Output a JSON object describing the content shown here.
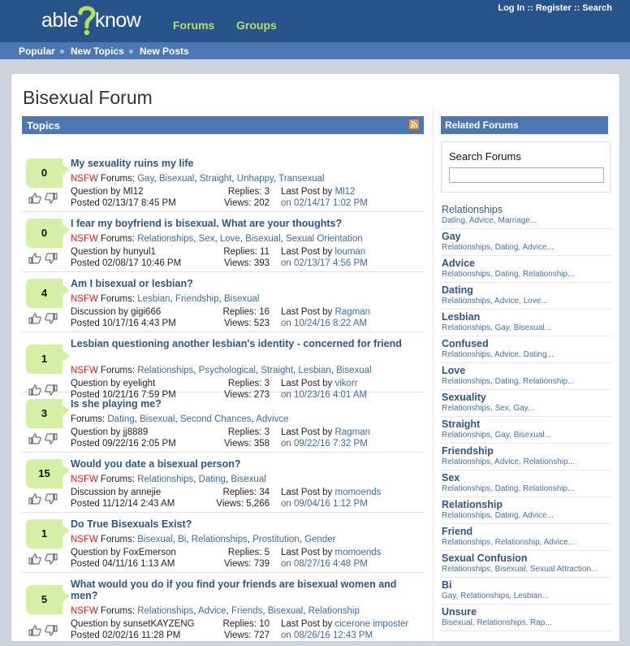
{
  "header": {
    "logo_text_left": "able",
    "logo_text_right": "know",
    "nav": [
      "Forums",
      "Groups"
    ],
    "auth_links": [
      "Log In",
      "Register",
      "Search"
    ],
    "auth_separator": " :: "
  },
  "subnav": [
    "Popular",
    "New Topics",
    "New Posts"
  ],
  "page_title": "Bisexual Forum",
  "topics_header": "Topics",
  "topics": [
    {
      "count": "0",
      "title": "My sexuality ruins my life",
      "nsfw": true,
      "forums": [
        "Gay",
        "Bisexual",
        "Straight",
        "Unhappy",
        "Transexual"
      ],
      "kind": "Question by",
      "author": "Ml12",
      "posted": "Posted 02/13/17 8:45 PM",
      "replies": "Replies: 3",
      "views": "Views: 202",
      "last_by": "Ml12",
      "last_on": "on 02/14/17 1:02 PM"
    },
    {
      "count": "0",
      "title": "I fear my boyfriend is bisexual. What are your thoughts?",
      "nsfw": true,
      "forums": [
        "Relationships",
        "Sex",
        "Love",
        "Bisexual",
        "Sexual Orientation"
      ],
      "kind": "Question by",
      "author": "hunyul1",
      "posted": "Posted 02/08/17 10:46 PM",
      "replies": "Replies: 11",
      "views": "Views: 393",
      "last_by": "louman",
      "last_on": "on 02/13/17 4:56 PM"
    },
    {
      "count": "4",
      "title": "Am I bisexual or lesbian?",
      "nsfw": true,
      "forums": [
        "Lesbian",
        "Friendship",
        "Bisexual"
      ],
      "kind": "Discussion by",
      "author": "gigi666",
      "posted": "Posted 10/17/16 4:43 PM",
      "replies": "Replies: 16",
      "views": "Views: 523",
      "last_by": "Ragman",
      "last_on": "on 10/24/16 8:22 AM"
    },
    {
      "count": "1",
      "title": "Lesbian questioning another lesbian's identity - concerned for friend",
      "nsfw": true,
      "forums": [
        "Relationships",
        "Psychological",
        "Straight",
        "Lesbian",
        "Bisexual"
      ],
      "kind": "Question by",
      "author": "eyelight",
      "posted": "Posted 10/21/16 7:59 PM",
      "replies": "Replies: 3",
      "views": "Views: 273",
      "last_by": "vikorr",
      "last_on": "on 10/23/16 4:01 AM"
    },
    {
      "count": "3",
      "title": "Is she playing me?",
      "nsfw": false,
      "forums": [
        "Dating",
        "Bisexual",
        "Second Chances",
        "Advivce"
      ],
      "kind": "Question by",
      "author": "jj8889",
      "posted": "Posted 09/22/16 2:05 PM",
      "replies": "Replies: 3",
      "views": "Views: 358",
      "last_by": "Ragman",
      "last_on": "on 09/22/16 7:32 PM"
    },
    {
      "count": "15",
      "title": "Would you date a bisexual person?",
      "nsfw": true,
      "forums": [
        "Relationships",
        "Dating",
        "Bisexual"
      ],
      "kind": "Discussion by",
      "author": "annejie",
      "posted": "Posted 11/12/14 2:43 AM",
      "replies": "Replies: 34",
      "views": "Views: 5,266",
      "last_by": "momoends",
      "last_on": "on 09/04/16 1:12 PM"
    },
    {
      "count": "1",
      "title": "Do True Bisexuals Exist?",
      "nsfw": true,
      "forums": [
        "Bisexual",
        "Bi",
        "Relationships",
        "Prostitution",
        "Gender"
      ],
      "kind": "Question by",
      "author": "FoxEmerson",
      "posted": "Posted 04/11/16 1:13 AM",
      "replies": "Replies: 5",
      "views": "Views: 739",
      "last_by": "momoends",
      "last_on": "on 08/27/16 4:48 PM"
    },
    {
      "count": "5",
      "title": "What would you do if you find your friends are bisexual women and men?",
      "nsfw": true,
      "forums": [
        "Relationships",
        "Advice",
        "Friends",
        "Bisexual",
        "Relationship"
      ],
      "kind": "Question by",
      "author": "sunsetKAYZENG",
      "posted": "Posted 02/02/16 11:28 PM",
      "replies": "Replies: 10",
      "views": "Views: 727",
      "last_by": "cicerone imposter",
      "last_on": "on 08/26/16 12:43 PM"
    }
  ],
  "labels": {
    "nsfw": "NSFW",
    "forums_prefix": "Forums:",
    "last_post_prefix": "Last Post by"
  },
  "related_header": "Related Forums",
  "search_forums": {
    "label": "Search Forums",
    "value": ""
  },
  "related_forums": [
    {
      "name": "Relationships",
      "tags": "Dating, Advice, Marriage..."
    },
    {
      "name": "Gay",
      "tags": "Relationships, Dating, Advice..."
    },
    {
      "name": "Advice",
      "tags": "Relationships, Dating, Relationship..."
    },
    {
      "name": "Dating",
      "tags": "Relationships, Advice, Love..."
    },
    {
      "name": "Lesbian",
      "tags": "Relationships, Gay, Bisexual..."
    },
    {
      "name": "Confused",
      "tags": "Relationships, Advice, Dating..."
    },
    {
      "name": "Love",
      "tags": "Relationships, Dating, Relationship..."
    },
    {
      "name": "Sexuality",
      "tags": "Relationships, Sex, Gay..."
    },
    {
      "name": "Straight",
      "tags": "Relationships, Gay, Bisexual..."
    },
    {
      "name": "Friendship",
      "tags": "Relationships, Advice, Relationship..."
    },
    {
      "name": "Sex",
      "tags": "Relationships, Dating, Relationship..."
    },
    {
      "name": "Relationship",
      "tags": "Relationships, Dating, Advice..."
    },
    {
      "name": "Friend",
      "tags": "Relationships, Relationship, Advice..."
    },
    {
      "name": "Sexual Confusion",
      "tags": "Relationships, Bisexual, Sexual Attraction..."
    },
    {
      "name": "Bi",
      "tags": "Gay, Relationships, Lesbian..."
    },
    {
      "name": "Unsure",
      "tags": "Bisexual, Relationships, Rap..."
    }
  ],
  "colors": {
    "header_bg": "#27548b",
    "subnav_bg": "#4d77b3",
    "accent_green": "#b6e15b",
    "count_bg": "#d4f0a7",
    "nsfw_red": "#e01c1c",
    "link_blue": "#3b6aa3"
  }
}
